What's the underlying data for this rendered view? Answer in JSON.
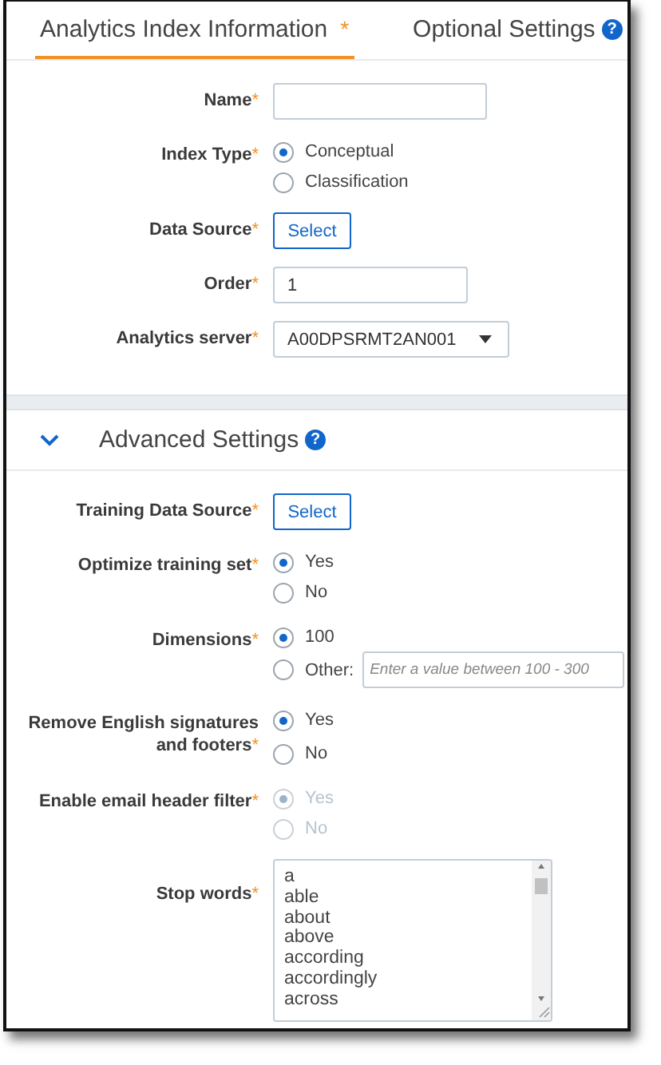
{
  "tabs": [
    {
      "label": "Analytics Index Information",
      "required_mark": "*",
      "selected": true
    },
    {
      "label": "Optional Settings",
      "help": "?",
      "selected": false
    }
  ],
  "main_fields": [
    {
      "kind": "text",
      "label": "Name",
      "required_mark": "*"
    },
    {
      "kind": "radio",
      "label": "Index Type",
      "required_mark": "*",
      "options": [
        {
          "label": "Conceptual",
          "selected": true
        },
        {
          "label": "Classification",
          "selected": false
        }
      ]
    },
    {
      "kind": "button",
      "label": "Data Source",
      "required_mark": "*",
      "button": "Select"
    },
    {
      "kind": "text",
      "label": "Order",
      "required_mark": "*",
      "value": "1"
    },
    {
      "kind": "select",
      "label": "Analytics server",
      "required_mark": "*",
      "value": "A00DPSRMT2AN001"
    }
  ],
  "advanced": {
    "title": "Advanced Settings",
    "help": "?",
    "expanded": true,
    "fields": [
      {
        "kind": "button",
        "label": "Training Data Source",
        "required_mark": "*",
        "button": "Select"
      },
      {
        "kind": "radio",
        "label": "Optimize training set",
        "required_mark": "*",
        "options": [
          {
            "label": "Yes",
            "selected": true
          },
          {
            "label": "No",
            "selected": false
          }
        ]
      },
      {
        "kind": "radio",
        "label": "Dimensions",
        "required_mark": "*",
        "options": [
          {
            "label": "100",
            "selected": true
          },
          {
            "label": "Other:",
            "selected": false,
            "placeholder": "Enter a value between 100 - 300"
          }
        ]
      },
      {
        "kind": "radio",
        "label": "Remove English signatures and footers",
        "required_mark": "*",
        "options": [
          {
            "label": "Yes",
            "selected": true
          },
          {
            "label": "No",
            "selected": false
          }
        ]
      },
      {
        "kind": "radio",
        "label": "Enable email header filter",
        "required_mark": "*",
        "disabled": true,
        "options": [
          {
            "label": "Yes",
            "selected": true
          },
          {
            "label": "No",
            "selected": false
          }
        ]
      },
      {
        "kind": "textarea",
        "label": "Stop words",
        "required_mark": "*",
        "lines": [
          "a",
          "able",
          "about",
          "above",
          "according",
          "accordingly",
          "across"
        ]
      }
    ]
  }
}
